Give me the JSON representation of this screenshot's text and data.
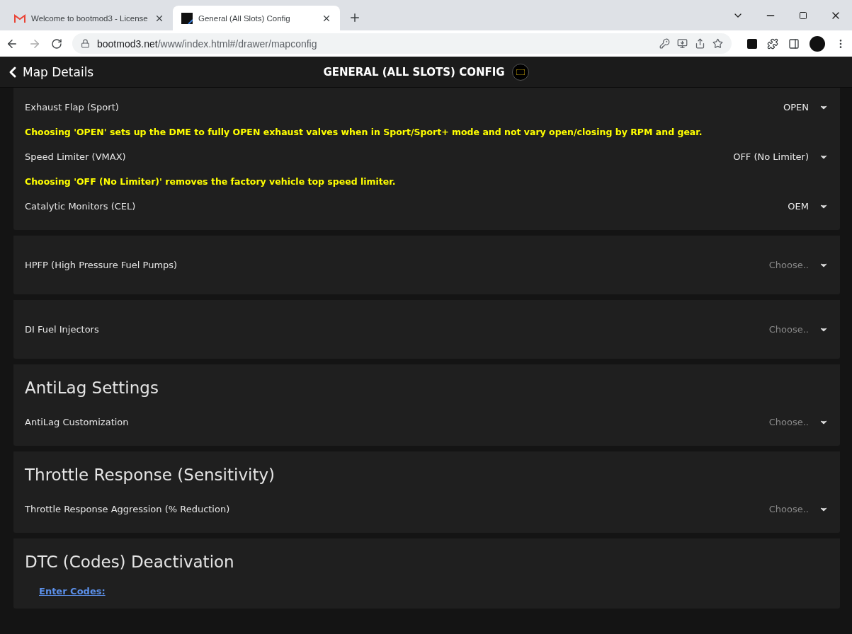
{
  "browser": {
    "tabs": [
      {
        "title": "Welcome to bootmod3 - License",
        "selected": false,
        "kind": "mail"
      },
      {
        "title": "General (All Slots) Config",
        "selected": true,
        "kind": "app"
      }
    ],
    "address": {
      "host": "bootmod3.net",
      "path": "/www/index.html#/drawer/mapconfig"
    }
  },
  "header": {
    "back": "Map Details",
    "title": "GENERAL (ALL SLOTS) CONFIG"
  },
  "sections": [
    {
      "rows": [
        {
          "kind": "select",
          "label": "Exhaust Flap (Sport)",
          "value": "OPEN"
        },
        {
          "kind": "note",
          "text": "Choosing 'OPEN' sets up the DME to fully OPEN exhaust valves when in Sport/Sport+ mode and not vary open/closing by RPM and gear."
        },
        {
          "kind": "select",
          "label": "Speed Limiter (VMAX)",
          "value": "OFF (No Limiter)"
        },
        {
          "kind": "note",
          "text": "Choosing 'OFF (No Limiter)' removes the factory vehicle top speed limiter."
        },
        {
          "kind": "select",
          "label": "Catalytic Monitors (CEL)",
          "value": "OEM"
        }
      ]
    },
    {
      "rows": [
        {
          "kind": "select",
          "label": "HPFP (High Pressure Fuel Pumps)",
          "placeholder": "Choose.."
        }
      ]
    },
    {
      "rows": [
        {
          "kind": "select",
          "label": "DI Fuel Injectors",
          "placeholder": "Choose.."
        }
      ]
    },
    {
      "heading": "AntiLag Settings",
      "rows": [
        {
          "kind": "select",
          "label": "AntiLag Customization",
          "placeholder": "Choose.."
        }
      ]
    },
    {
      "heading": "Throttle Response (Sensitivity)",
      "rows": [
        {
          "kind": "select",
          "label": "Throttle Response Aggression (% Reduction)",
          "placeholder": "Choose.."
        }
      ]
    },
    {
      "heading": "DTC (Codes) Deactivation",
      "rows": [
        {
          "kind": "link",
          "text": "Enter Codes:"
        }
      ]
    }
  ]
}
